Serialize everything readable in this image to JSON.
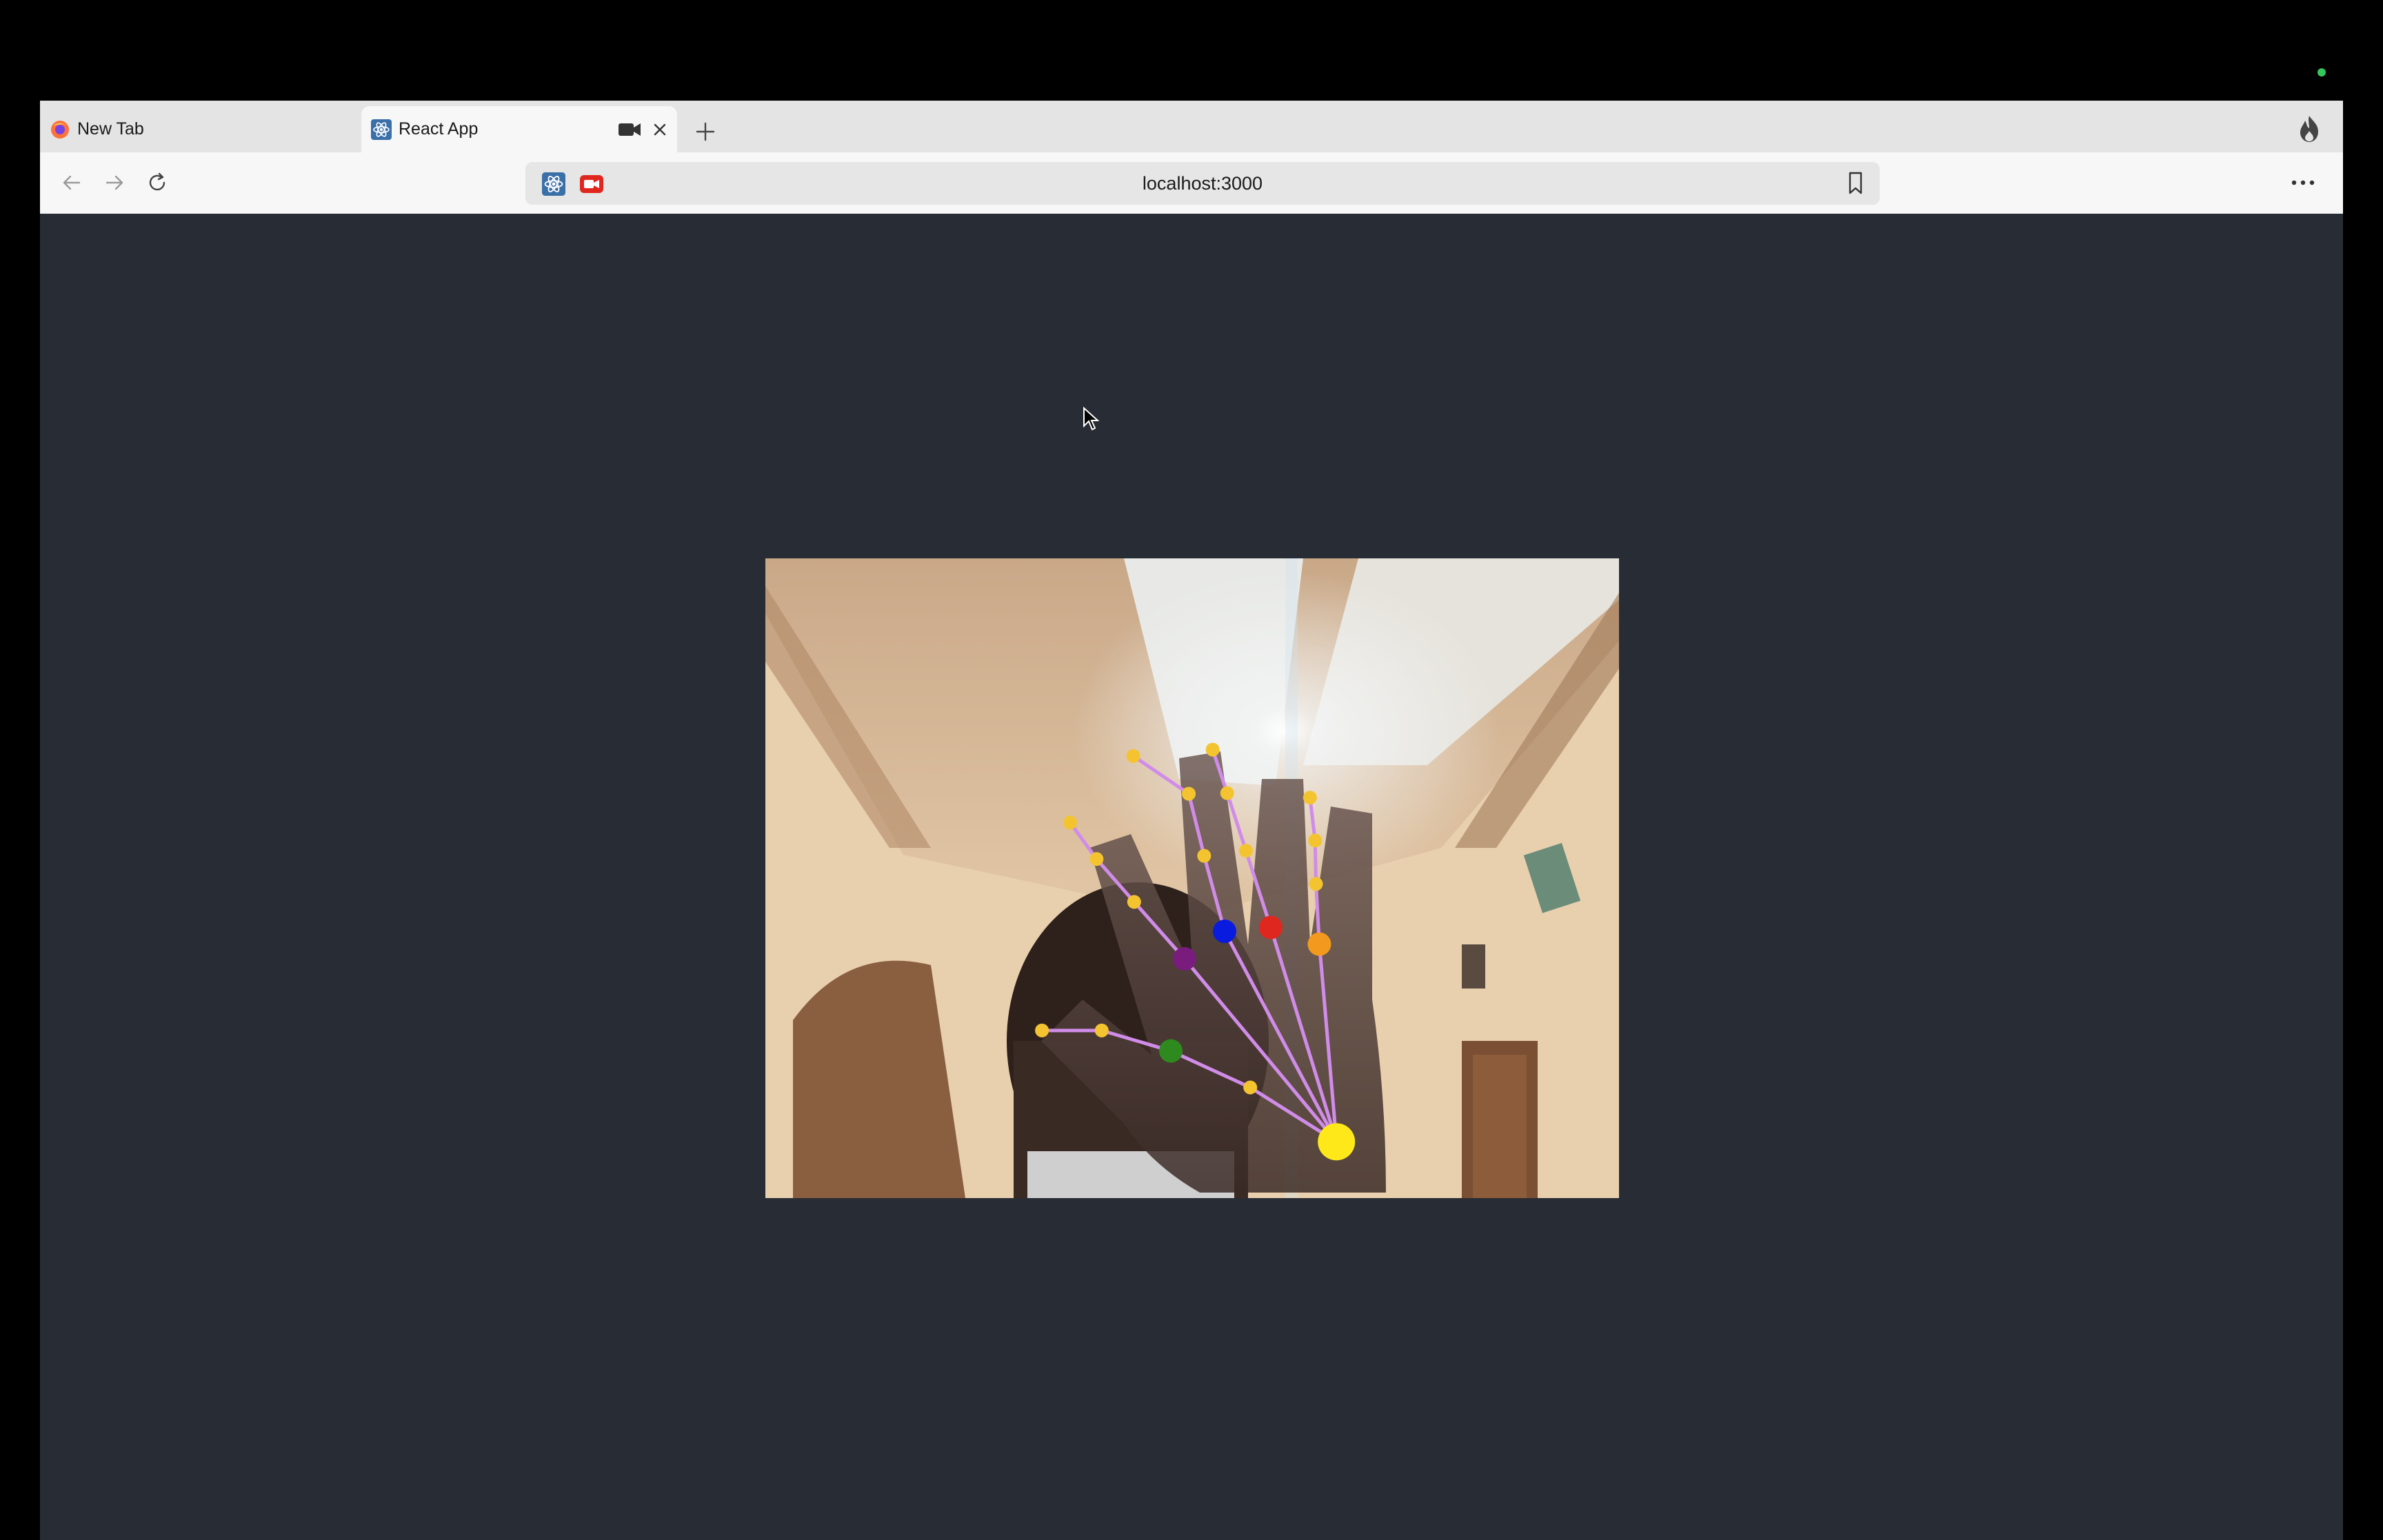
{
  "browser": {
    "tabs": [
      {
        "label": "New Tab"
      },
      {
        "label": "React App"
      }
    ],
    "address_bar": {
      "url": "localhost:3000"
    }
  },
  "icons": {
    "tab_newtab_favicon": "firefox-logo-icon",
    "tab_react_favicon": "react-logo-icon",
    "tab_camera": "camera-icon",
    "tab_close": "close-icon",
    "new_tab": "plus-icon",
    "flame": "flame-icon",
    "back": "arrow-left-icon",
    "forward": "arrow-right-icon",
    "reload": "reload-icon",
    "bookmark": "bookmark-icon",
    "menu": "more-horizontal-icon",
    "camera_active": "camera-active-icon"
  },
  "colors": {
    "page_background": "#282c34",
    "landmark_line": "#d08ce8",
    "landmark_point": "#f4c430",
    "palm_purple": "#7a1b7e",
    "palm_blue": "#0a1be0",
    "palm_red": "#e0271f",
    "palm_orange": "#f39a1e",
    "thumb_green": "#2e8a1f",
    "wrist_yellow": "#ffe81a"
  },
  "hand_landmarks": {
    "wrist": [
      0.669,
      0.912
    ],
    "thumb": [
      [
        0.568,
        0.827
      ],
      [
        0.475,
        0.77
      ],
      [
        0.394,
        0.738
      ],
      [
        0.324,
        0.738
      ]
    ],
    "index": [
      [
        0.491,
        0.626
      ],
      [
        0.432,
        0.537
      ],
      [
        0.388,
        0.47
      ],
      [
        0.357,
        0.413
      ]
    ],
    "middle": [
      [
        0.538,
        0.583
      ],
      [
        0.514,
        0.465
      ],
      [
        0.496,
        0.368
      ],
      [
        0.431,
        0.309
      ]
    ],
    "ring": [
      [
        0.592,
        0.577
      ],
      [
        0.563,
        0.457
      ],
      [
        0.541,
        0.367
      ],
      [
        0.524,
        0.299
      ]
    ],
    "pinky": [
      [
        0.649,
        0.603
      ],
      [
        0.645,
        0.509
      ],
      [
        0.644,
        0.441
      ],
      [
        0.638,
        0.374
      ]
    ]
  }
}
